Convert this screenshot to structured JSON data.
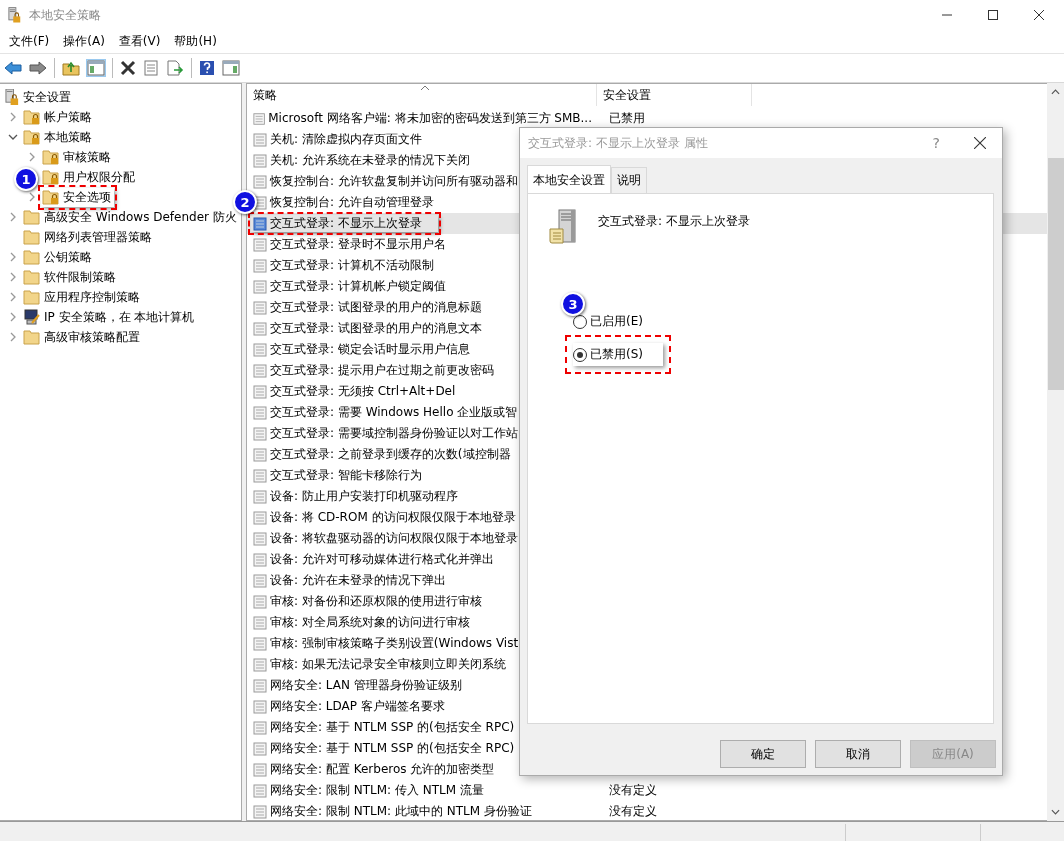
{
  "window": {
    "title": "本地安全策略"
  },
  "menu": [
    "文件(F)",
    "操作(A)",
    "查看(V)",
    "帮助(H)"
  ],
  "tree": [
    {
      "label": "安全设置",
      "kind": "root",
      "children": [
        {
          "label": "帐户策略",
          "kind": "locked-folder",
          "expanded": false
        },
        {
          "label": "本地策略",
          "kind": "locked-folder",
          "expanded": true,
          "children": [
            {
              "label": "审核策略",
              "kind": "locked-folder",
              "expanded": false
            },
            {
              "label": "用户权限分配",
              "kind": "locked-folder"
            },
            {
              "label": "安全选项",
              "kind": "locked-folder",
              "expanded": false,
              "outlined": true,
              "callout": "1"
            }
          ]
        },
        {
          "label": "高级安全 Windows Defender 防火",
          "kind": "folder",
          "expanded": false
        },
        {
          "label": "网络列表管理器策略",
          "kind": "folder"
        },
        {
          "label": "公钥策略",
          "kind": "folder",
          "expanded": false
        },
        {
          "label": "软件限制策略",
          "kind": "folder",
          "expanded": false
        },
        {
          "label": "应用程序控制策略",
          "kind": "folder",
          "expanded": false
        },
        {
          "label": "IP 安全策略，在 本地计算机",
          "kind": "computer",
          "expanded": false
        },
        {
          "label": "高级审核策略配置",
          "kind": "folder",
          "expanded": false
        }
      ]
    }
  ],
  "table": {
    "columns": [
      "策略",
      "安全设置"
    ],
    "rows": [
      {
        "policy": "Microsoft 网络客户端: 将未加密的密码发送到第三方 SMB...",
        "setting": "已禁用",
        "selected": false
      },
      {
        "policy": "关机: 清除虚拟内存页面文件",
        "selected": false
      },
      {
        "policy": "关机: 允许系统在未登录的情况下关闭",
        "selected": false
      },
      {
        "policy": "恢复控制台: 允许软盘复制并访问所有驱动器和",
        "selected": false
      },
      {
        "policy": "恢复控制台: 允许自动管理登录",
        "selected": false
      },
      {
        "policy": "交互式登录: 不显示上次登录",
        "selected": true,
        "outlined": true,
        "callout": "2"
      },
      {
        "policy": "交互式登录: 登录时不显示用户名",
        "selected": false
      },
      {
        "policy": "交互式登录: 计算机不活动限制",
        "selected": false
      },
      {
        "policy": "交互式登录: 计算机帐户锁定阈值",
        "selected": false
      },
      {
        "policy": "交互式登录: 试图登录的用户的消息标题",
        "selected": false
      },
      {
        "policy": "交互式登录: 试图登录的用户的消息文本",
        "selected": false
      },
      {
        "policy": "交互式登录: 锁定会话时显示用户信息",
        "selected": false
      },
      {
        "policy": "交互式登录: 提示用户在过期之前更改密码",
        "selected": false
      },
      {
        "policy": "交互式登录: 无须按 Ctrl+Alt+Del",
        "selected": false
      },
      {
        "policy": "交互式登录: 需要 Windows Hello 企业版或智",
        "selected": false
      },
      {
        "policy": "交互式登录: 需要域控制器身份验证以对工作站",
        "selected": false
      },
      {
        "policy": "交互式登录: 之前登录到缓存的次数(域控制器",
        "selected": false
      },
      {
        "policy": "交互式登录: 智能卡移除行为",
        "selected": false
      },
      {
        "policy": "设备: 防止用户安装打印机驱动程序",
        "selected": false
      },
      {
        "policy": "设备: 将 CD-ROM 的访问权限仅限于本地登录",
        "selected": false
      },
      {
        "policy": "设备: 将软盘驱动器的访问权限仅限于本地登录",
        "selected": false
      },
      {
        "policy": "设备: 允许对可移动媒体进行格式化并弹出",
        "selected": false
      },
      {
        "policy": "设备: 允许在未登录的情况下弹出",
        "selected": false
      },
      {
        "policy": "审核: 对备份和还原权限的使用进行审核",
        "selected": false
      },
      {
        "policy": "审核: 对全局系统对象的访问进行审核",
        "selected": false
      },
      {
        "policy": "审核: 强制审核策略子类别设置(Windows Vist",
        "selected": false
      },
      {
        "policy": "审核: 如果无法记录安全审核则立即关闭系统",
        "selected": false
      },
      {
        "policy": "网络安全: LAN 管理器身份验证级别",
        "selected": false
      },
      {
        "policy": "网络安全: LDAP 客户端签名要求",
        "selected": false
      },
      {
        "policy": "网络安全: 基于 NTLM SSP 的(包括安全 RPC)",
        "selected": false
      },
      {
        "policy": "网络安全: 基于 NTLM SSP 的(包括安全 RPC)",
        "selected": false
      },
      {
        "policy": "网络安全: 配置 Kerberos 允许的加密类型",
        "selected": false
      },
      {
        "policy": "网络安全: 限制 NTLM: 传入 NTLM 流量",
        "setting": "没有定义",
        "selected": false
      },
      {
        "policy": "网络安全: 限制 NTLM: 此域中的 NTLM 身份验证",
        "setting": "没有定义",
        "selected": false
      }
    ]
  },
  "dialog": {
    "title": "交互式登录: 不显示上次登录 属性",
    "help": "?",
    "tabs": [
      {
        "label": "本地安全设置",
        "selected": true
      },
      {
        "label": "说明",
        "selected": false
      }
    ],
    "policy_name": "交互式登录: 不显示上次登录",
    "callout": "3",
    "options": [
      {
        "label": "已启用(E)",
        "checked": false,
        "outlined": false
      },
      {
        "label": "已禁用(S)",
        "checked": true,
        "outlined": true
      }
    ],
    "buttons": [
      {
        "label": "确定",
        "disabled": false
      },
      {
        "label": "取消",
        "disabled": false
      },
      {
        "label": "应用(A)",
        "disabled": true
      }
    ]
  }
}
